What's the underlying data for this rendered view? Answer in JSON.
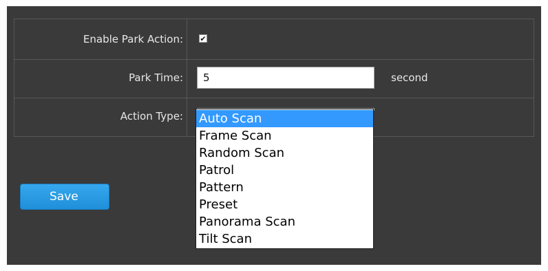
{
  "park_settings": {
    "enable_park_action": {
      "label": "Enable Park Action:",
      "checked": true,
      "check_glyph": "✔"
    },
    "park_time": {
      "label": "Park Time:",
      "value": "5",
      "unit": "second"
    },
    "action_type": {
      "label": "Action Type:",
      "selected": "Auto Scan",
      "options": [
        "Auto Scan",
        "Frame Scan",
        "Random Scan",
        "Patrol",
        "Pattern",
        "Preset",
        "Panorama Scan",
        "Tilt Scan"
      ]
    }
  },
  "actions": {
    "save_label": "Save"
  },
  "colors": {
    "panel_background": "#3a3a3a",
    "selected_option": "#3399ff",
    "save_button": "#2b9ce6"
  }
}
